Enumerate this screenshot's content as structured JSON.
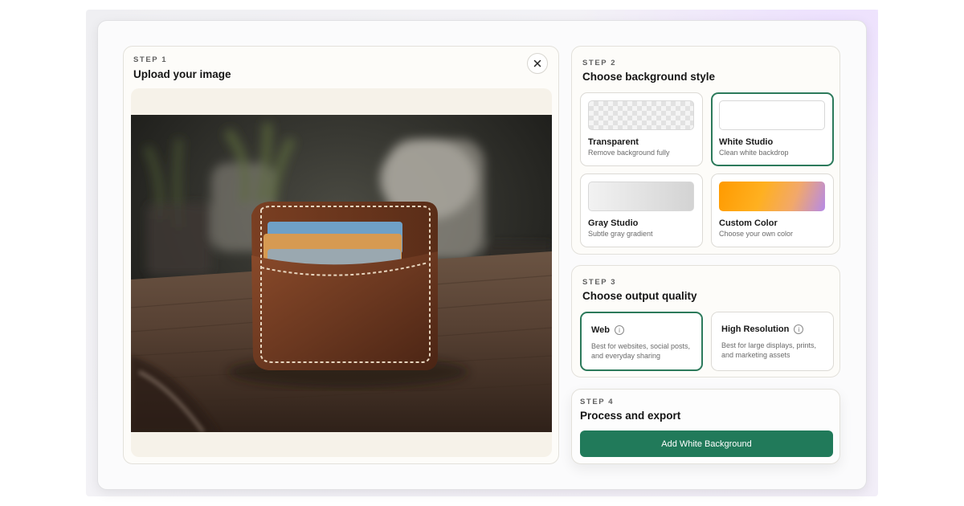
{
  "step1": {
    "label": "STEP 1",
    "title": "Upload your image",
    "close_icon": "close-icon"
  },
  "step2": {
    "label": "STEP 2",
    "title": "Choose background style",
    "options": [
      {
        "title": "Transparent",
        "subtitle": "Remove background fully",
        "selected": false
      },
      {
        "title": "White Studio",
        "subtitle": "Clean white backdrop",
        "selected": true
      },
      {
        "title": "Gray Studio",
        "subtitle": "Subtle gray gradient",
        "selected": false
      },
      {
        "title": "Custom Color",
        "subtitle": "Choose your own color",
        "selected": false
      }
    ]
  },
  "step3": {
    "label": "STEP 3",
    "title": "Choose output quality",
    "options": [
      {
        "title": "Web",
        "subtitle": "Best for websites, social posts, and everyday sharing",
        "selected": true
      },
      {
        "title": "High Resolution",
        "subtitle": "Best for large displays, prints, and marketing assets",
        "selected": false
      }
    ],
    "info_icon": "info-icon"
  },
  "step4": {
    "label": "STEP 4",
    "title": "Process and export",
    "button_label": "Add White Background"
  },
  "colors": {
    "accent": "#217a5a",
    "selected_border": "#2c7a5b",
    "panel_bg": "#fdfcf9",
    "image_area_bg": "#f6f2e9"
  }
}
